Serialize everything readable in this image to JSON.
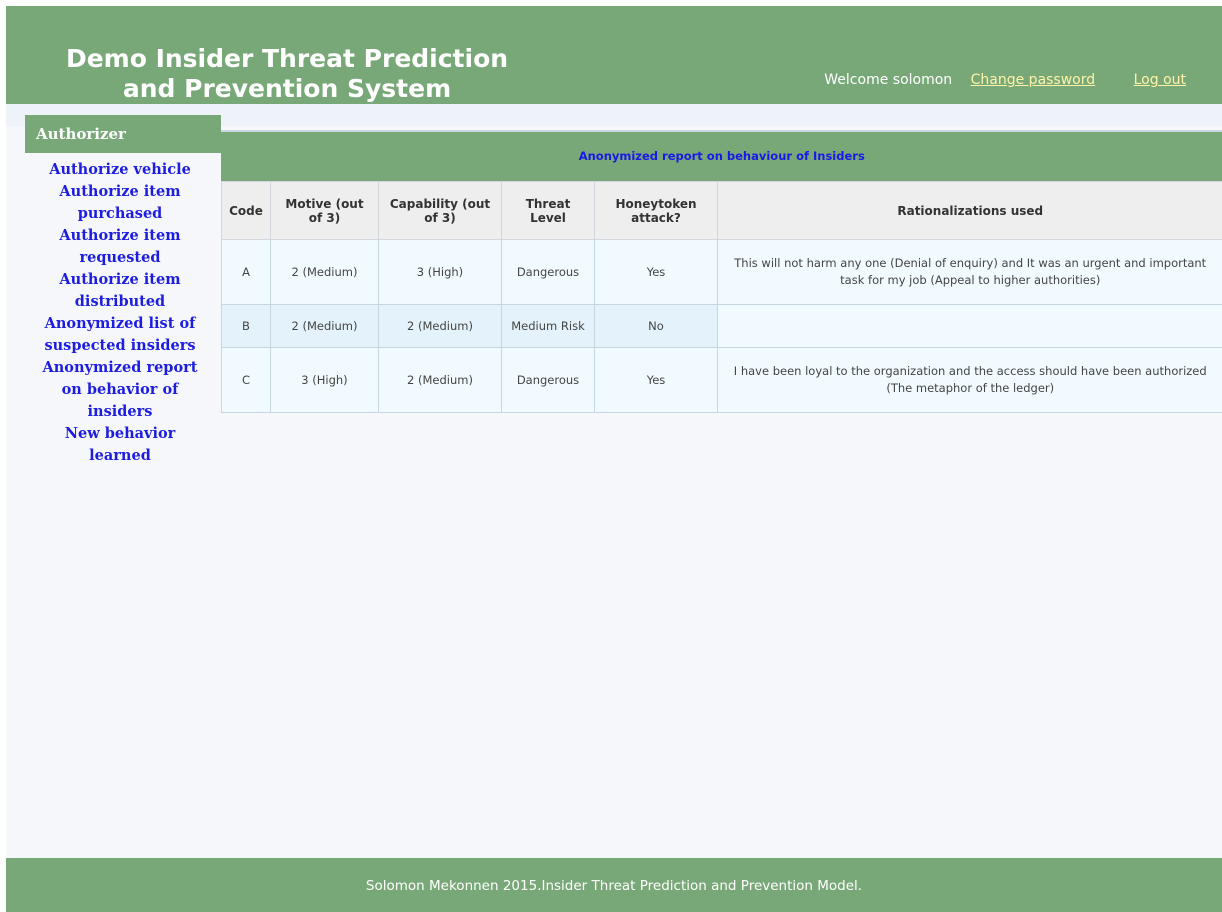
{
  "header": {
    "title": "Demo Insider Threat Prediction and Prevention System",
    "welcome_text": "Welcome solomon",
    "change_password": "Change password",
    "logout": "Log out"
  },
  "sidebar": {
    "title": "Authorizer",
    "items": [
      {
        "label": "Authorize vehicle"
      },
      {
        "label": "Authorize item purchased"
      },
      {
        "label": "Authorize item requested"
      },
      {
        "label": "Authorize item distributed"
      },
      {
        "label": "Anonymized list of suspected insiders"
      },
      {
        "label": "Anonymized report on behavior of insiders"
      },
      {
        "label": "New behavior learned"
      }
    ]
  },
  "report": {
    "caption": "Anonymized report on behaviour of Insiders",
    "columns": [
      "Code",
      "Motive (out of 3)",
      "Capability (out of 3)",
      "Threat Level",
      "Honeytoken attack?",
      "Rationalizations used"
    ],
    "rows": [
      {
        "code": "A",
        "motive": "2 (Medium)",
        "capability": "3 (High)",
        "threat_level": "Dangerous",
        "honeytoken": "Yes",
        "rationalizations": "This will not harm any one (Denial of enquiry) and It was an urgent and important task for my job (Appeal to higher authorities)"
      },
      {
        "code": "B",
        "motive": "2 (Medium)",
        "capability": "2 (Medium)",
        "threat_level": "Medium Risk",
        "honeytoken": "No",
        "rationalizations": ""
      },
      {
        "code": "C",
        "motive": "3 (High)",
        "capability": "2 (Medium)",
        "threat_level": "Dangerous",
        "honeytoken": "Yes",
        "rationalizations": "I have been loyal to the organization and the access should have been authorized (The metaphor of the ledger)"
      }
    ]
  },
  "footer": {
    "text": "Solomon Mekonnen 2015.Insider Threat Prediction and Prevention Model."
  },
  "colors": {
    "header_green": "#79a878",
    "link_blue": "#1d1de0",
    "header_link_yellow": "#fff3a8",
    "table_row_bg": "#f1fbff"
  }
}
